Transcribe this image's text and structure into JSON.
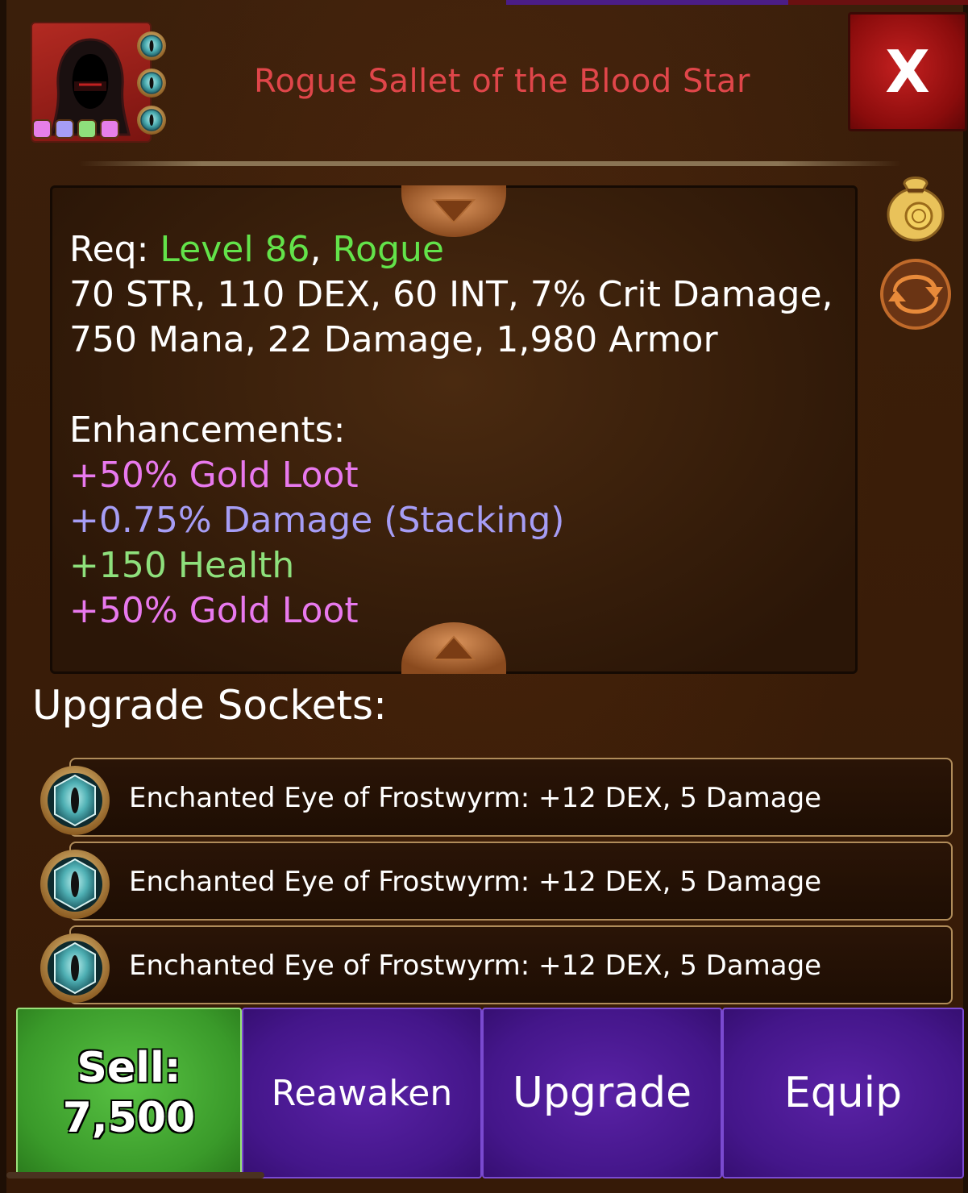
{
  "item": {
    "title": "Rogue Sallet of the Blood Star",
    "close_label": "X",
    "title_color": "#e0464a"
  },
  "portrait": {
    "icon": "hooded-rogue-icon",
    "rarity_colors": [
      "#e67fe8",
      "#a69df5",
      "#8ee07c",
      "#e67fe8"
    ],
    "socket_icons": [
      "frostwyrm-eye-icon",
      "frostwyrm-eye-icon",
      "frostwyrm-eye-icon"
    ]
  },
  "requirements": {
    "req_label": "Req:",
    "level": "Level 86",
    "separator": ",",
    "class": "Rogue",
    "stats_line1": "70 STR, 110 DEX, 60 INT, 7% Crit Damage,",
    "stats_line2": "750 Mana, 22 Damage, 1,980 Armor"
  },
  "enhancements": {
    "heading": "Enhancements:",
    "items": [
      {
        "text": "+50% Gold Loot",
        "color": "pink"
      },
      {
        "text": "+0.75% Damage (Stacking)",
        "color": "blue"
      },
      {
        "text": "+150 Health",
        "color": "lgreen"
      },
      {
        "text": "+50% Gold Loot",
        "color": "pink"
      }
    ]
  },
  "side_icons": [
    "gold-bag-icon",
    "swap-arrows-icon"
  ],
  "sockets": {
    "heading": "Upgrade Sockets:",
    "items": [
      {
        "text": "Enchanted Eye of Frostwyrm: +12 DEX, 5 Damage",
        "icon": "frostwyrm-eye-icon"
      },
      {
        "text": "Enchanted Eye of Frostwyrm: +12 DEX, 5 Damage",
        "icon": "frostwyrm-eye-icon"
      },
      {
        "text": "Enchanted Eye of Frostwyrm: +12 DEX, 5 Damage",
        "icon": "frostwyrm-eye-icon"
      }
    ]
  },
  "actions": {
    "sell_label": "Sell:",
    "sell_value": "7,500",
    "reawaken_label": "Reawaken",
    "upgrade_label": "Upgrade",
    "equip_label": "Equip"
  }
}
